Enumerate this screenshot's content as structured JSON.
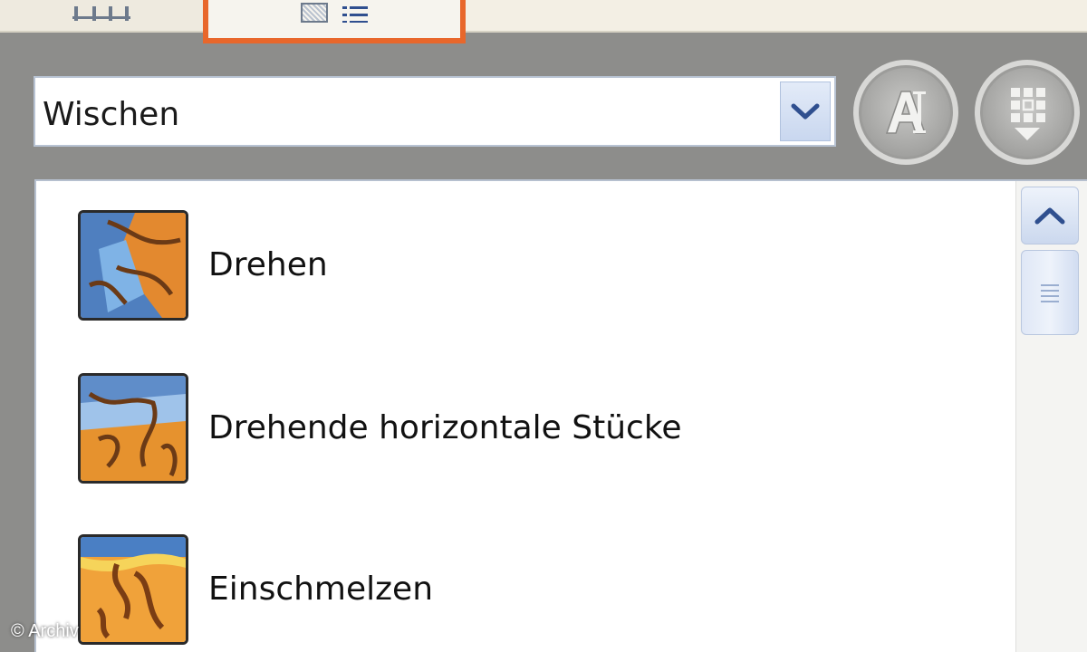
{
  "tabs": [
    {
      "name": "slides-tab",
      "icon": "slides-grid-icon"
    },
    {
      "name": "outline-tab",
      "icon": "outline-list-icon",
      "active": true
    }
  ],
  "effect_category": {
    "selected": "Wischen"
  },
  "buttons": [
    {
      "icon": "autotext-icon"
    },
    {
      "icon": "grid-dropdown-icon"
    }
  ],
  "transitions": [
    {
      "label": "Drehen",
      "icon": "transition-thumb-icon"
    },
    {
      "label": "Drehende horizontale Stücke",
      "icon": "transition-thumb-icon"
    },
    {
      "label": "Einschmelzen",
      "icon": "transition-thumb-icon"
    }
  ],
  "watermark": "© Archiv",
  "colors": {
    "active_tab_border": "#e8672b",
    "panel_bg": "#8d8d8b",
    "dropdown_arrow": "#2f4f8f"
  }
}
